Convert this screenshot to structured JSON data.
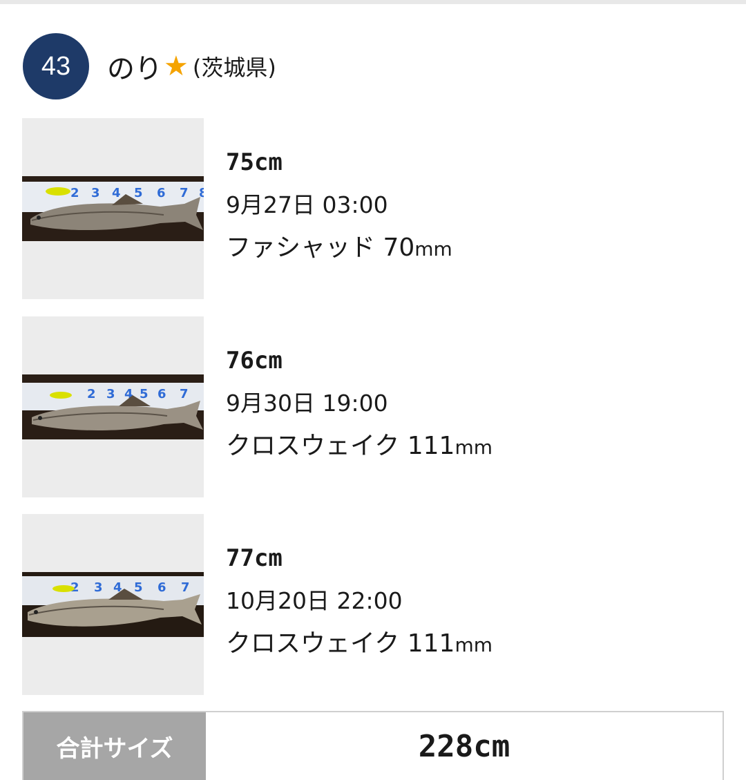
{
  "angler": {
    "rank": "43",
    "name": "のり",
    "star": "★",
    "prefecture": "(茨城県)"
  },
  "catches": [
    {
      "size": "75cm",
      "datetime": "9月27日 03:00",
      "lure_name": "ファシャッド",
      "lure_size": "70",
      "lure_unit": "mm",
      "photo": "seabass-on-measuring-board-photo"
    },
    {
      "size": "76cm",
      "datetime": "9月30日 19:00",
      "lure_name": "クロスウェイク",
      "lure_size": "111",
      "lure_unit": "mm",
      "photo": "seabass-on-measuring-board-photo"
    },
    {
      "size": "77cm",
      "datetime": "10月20日 22:00",
      "lure_name": "クロスウェイク",
      "lure_size": "111",
      "lure_unit": "mm",
      "photo": "seabass-on-measuring-board-photo"
    }
  ],
  "total": {
    "label": "合計サイズ",
    "value": "228cm"
  },
  "colors": {
    "badge": "#1e3a68",
    "star": "#f5a300",
    "total_label_bg": "#a6a6a6",
    "thumb_bg": "#ececec"
  }
}
